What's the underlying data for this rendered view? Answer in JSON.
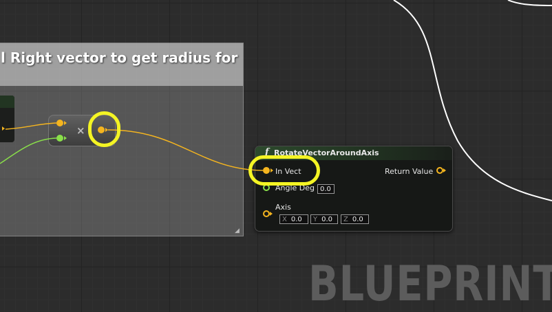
{
  "comment": {
    "title": "l Right vector to get radius for"
  },
  "multiply_node": {
    "symbol": "×"
  },
  "function_node": {
    "icon": "function-f-icon",
    "title": "RotateVectorAroundAxis",
    "pins": {
      "in_vect_label": "In Vect",
      "angle_deg_label": "Angle Deg",
      "angle_deg_value": "0.0",
      "axis_label": "Axis",
      "axis_x_letter": "X",
      "axis_x_value": "0.0",
      "axis_y_letter": "Y",
      "axis_y_value": "0.0",
      "axis_z_letter": "Z",
      "axis_z_value": "0.0",
      "return_value_label": "Return Value"
    }
  },
  "watermark": {
    "text": "BLUEPRINT"
  },
  "colors": {
    "vector_pin": "#f5b51f",
    "float_pin": "#8ae04a",
    "highlight": "#f4f424",
    "exec_wire": "#ffffff"
  }
}
